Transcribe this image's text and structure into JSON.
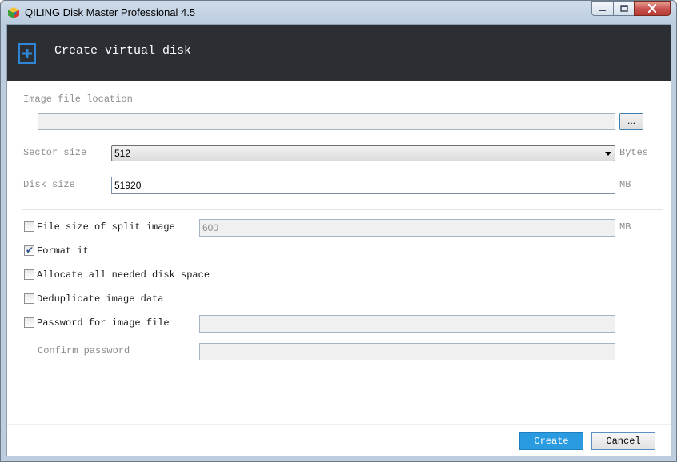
{
  "window": {
    "title": "QILING Disk Master Professional 4.5"
  },
  "header": {
    "title": "Create virtual disk",
    "icon": "add-disk-icon"
  },
  "form": {
    "image_location": {
      "label": "Image file location",
      "value": "",
      "browse_label": "..."
    },
    "sector_size": {
      "label": "Sector size",
      "value": "512",
      "unit": "Bytes"
    },
    "disk_size": {
      "label": "Disk size",
      "value": "51920",
      "unit": "MB"
    },
    "split_image": {
      "label": "File size of split image",
      "checked": false,
      "value": "600",
      "unit": "MB"
    },
    "format_it": {
      "label": "Format it",
      "checked": true
    },
    "allocate": {
      "label": "Allocate all needed disk space",
      "checked": false
    },
    "deduplicate": {
      "label": "Deduplicate image data",
      "checked": false
    },
    "password": {
      "label": "Password for image file",
      "checked": false,
      "value": ""
    },
    "confirm_password": {
      "label": "Confirm password",
      "value": ""
    }
  },
  "buttons": {
    "create": "Create",
    "cancel": "Cancel"
  },
  "colors": {
    "header_bg": "#2b2e33",
    "accent": "#2a9be0"
  }
}
